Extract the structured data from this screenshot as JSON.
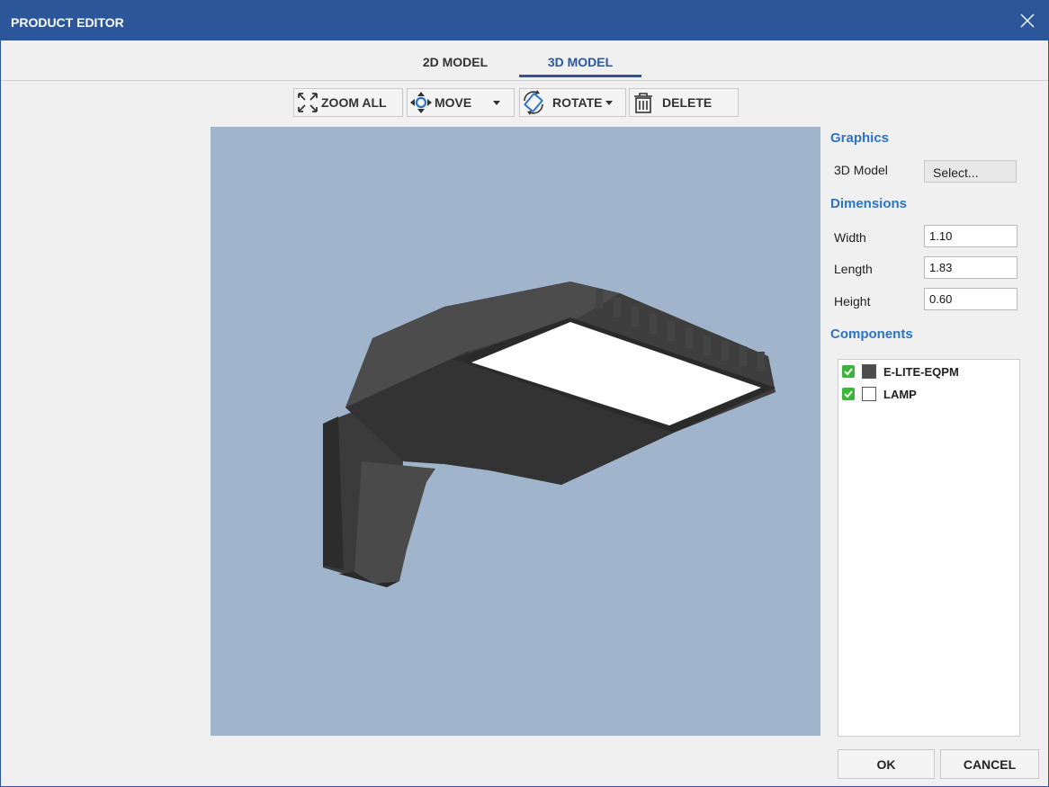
{
  "window": {
    "title": "PRODUCT EDITOR"
  },
  "tabs": [
    {
      "label": "2D MODEL",
      "active": false
    },
    {
      "label": "3D MODEL",
      "active": true
    }
  ],
  "toolbar": {
    "zoom_all": "ZOOM ALL",
    "move": "MOVE",
    "rotate": "ROTATE",
    "delete": "DELETE"
  },
  "viewport": {
    "background": "#a0b4cb",
    "model_color": "#4a4a4a",
    "lens_color": "#ffffff"
  },
  "panel": {
    "graphics": {
      "title": "Graphics",
      "model_label": "3D Model",
      "select_button": "Select..."
    },
    "dimensions": {
      "title": "Dimensions",
      "width_label": "Width",
      "width_value": "1.10",
      "length_label": "Length",
      "length_value": "1.83",
      "height_label": "Height",
      "height_value": "0.60"
    },
    "components": {
      "title": "Components",
      "items": [
        {
          "name": "E-LITE-EQPM",
          "checked": true,
          "color": "#4d4d4d"
        },
        {
          "name": "LAMP",
          "checked": true,
          "color": "#ffffff"
        }
      ]
    }
  },
  "buttons": {
    "ok": "OK",
    "cancel": "CANCEL"
  },
  "colors": {
    "accent": "#2b579a",
    "section_title": "#2b73c4",
    "check": "#3bb53b"
  }
}
